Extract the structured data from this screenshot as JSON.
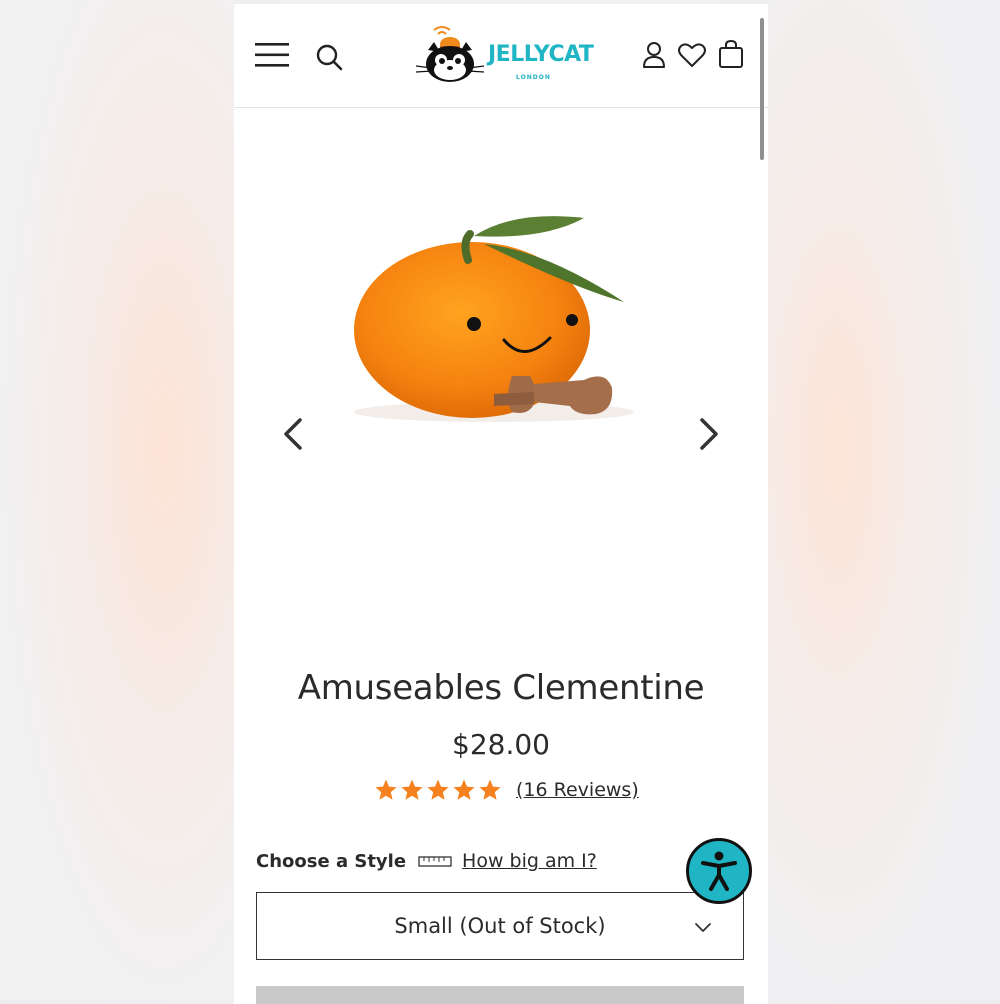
{
  "brand": {
    "name": "JELLYCAT",
    "sub": "LONDON",
    "accent": "#1fb5c4"
  },
  "header": {
    "icons": [
      "menu-icon",
      "search-icon",
      "account-icon",
      "heart-icon",
      "bag-icon"
    ]
  },
  "product": {
    "title": "Amuseables Clementine",
    "price": "$28.00",
    "rating": 5,
    "reviews_label": "(16 Reviews)",
    "star_color": "#f5821f"
  },
  "style_picker": {
    "label": "Choose a Style",
    "size_link": "How big am I?",
    "selected": "Small (Out of Stock)"
  },
  "colors": {
    "accessibility_button": "#1fb5c4",
    "add_button_disabled": "#c9c9c9"
  }
}
